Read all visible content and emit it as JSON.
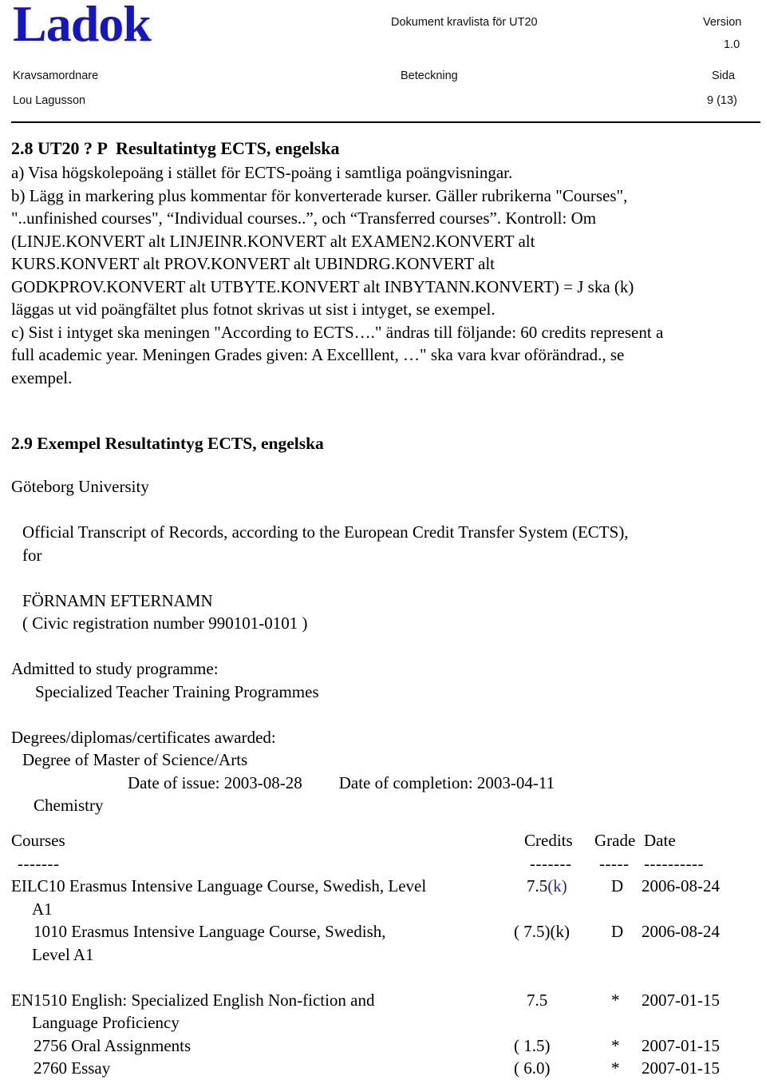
{
  "header": {
    "logo": "Ladok",
    "document_label": "Dokument",
    "document_value": "kravlista för UT20",
    "version_label": "Version",
    "version_value": "1.0",
    "role_label": "Kravsamordnare",
    "role_value": "Lou Lagusson",
    "beteckning_label": "Beteckning",
    "sida_label": "Sida",
    "sida_value": "9 (13)"
  },
  "section_28": {
    "number": "2.8 UT20 ? P",
    "title": "Resultatintyg ECTS, engelska",
    "lines": [
      "a) Visa högskolepoäng i stället för ECTS-poäng i samtliga poängvisningar.",
      "b) Lägg in markering plus kommentar för konverterade kurser. Gäller rubrikerna \"Courses\",",
      "\"..unfinished courses\", “Individual courses..”, och “Transferred courses”. Kontroll: Om",
      "(LINJE.KONVERT  alt LINJEINR.KONVERT alt EXAMEN2.KONVERT alt",
      "KURS.KONVERT alt PROV.KONVERT alt UBINDRG.KONVERT alt",
      "GODKPROV.KONVERT alt UTBYTE.KONVERT alt INBYTANN.KONVERT) = J ska (k)",
      "läggas ut vid poängfältet plus fotnot skrivas ut sist i intyget, se exempel.",
      "c) Sist i intyget ska meningen \"According to ECTS….\" ändras till följande: 60 credits represent a",
      "full academic year. Meningen Grades given: A Excelllent, …\" ska vara kvar oförändrad., se",
      "exempel."
    ]
  },
  "section_29": {
    "heading": "2.9 Exempel Resultatintyg ECTS, engelska",
    "university": "Göteborg University",
    "transcript_title_line1": "Official Transcript of Records, according to the European Credit Transfer System (ECTS),",
    "transcript_title_line2": "for",
    "student_name": "FÖRNAMN EFTERNAMN",
    "civic_registration": "( Civic registration number  990101-0101  )",
    "admitted_label": "Admitted to study programme:",
    "admitted_value": "Specialized Teacher Training Programmes",
    "degrees_label": "Degrees/diplomas/certificates awarded:",
    "degree_value": "Degree of Master of Science/Arts",
    "date_of_issue": "Date of issue: 2003-08-28",
    "date_of_completion": "Date of completion: 2003-04-11",
    "subject": "Chemistry"
  },
  "table": {
    "headers": {
      "courses": "Courses",
      "credits": "Credits",
      "grade": "Grade",
      "date": "Date"
    },
    "dashes": {
      "courses": "-------",
      "credits": "-------",
      "grade": "-----",
      "date": "----------"
    },
    "rows": [
      {
        "name": "EILC10 Erasmus Intensive Language Course, Swedish, Level",
        "credits": "7.5",
        "credits_suffix": "(k)",
        "credits_suffix_blue": true,
        "grade": "D",
        "date": "2006-08-24",
        "continuation": "A1",
        "continuation_indent": "2"
      },
      {
        "name": "1010  Erasmus Intensive Language Course, Swedish,",
        "credits": "( 7.5)(k)",
        "credits_suffix": "",
        "credits_suffix_blue": false,
        "grade": "D",
        "date": "2006-08-24",
        "continuation": "Level A1",
        "continuation_indent": "2"
      },
      {
        "name": "EN1510 English: Specialized English Non-fiction and",
        "credits": "7.5",
        "credits_suffix": "",
        "credits_suffix_blue": false,
        "grade": "*",
        "date": "2007-01-15",
        "continuation": "Language Proficiency",
        "continuation_indent": "2"
      },
      {
        "name": "2756  Oral Assignments",
        "credits": "( 1.5)",
        "credits_suffix": "",
        "credits_suffix_blue": false,
        "grade": "*",
        "date": "2007-01-15",
        "continuation": "",
        "continuation_indent": "2"
      },
      {
        "name": "2760  Essay",
        "credits": "( 6.0)",
        "credits_suffix": "",
        "credits_suffix_blue": false,
        "grade": "*",
        "date": "2007-01-15",
        "continuation": "",
        "continuation_indent": "2"
      }
    ]
  },
  "colors": {
    "logo_blue": "#1414c8",
    "marker_blue": "#2a2a9e",
    "text": "#000000"
  }
}
